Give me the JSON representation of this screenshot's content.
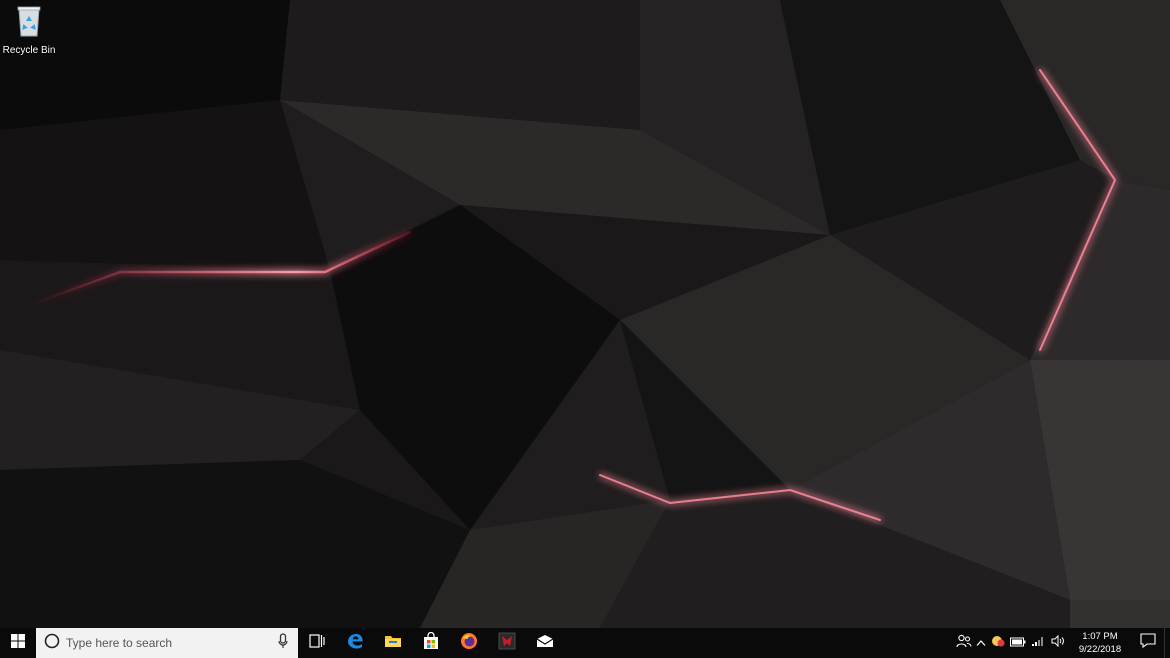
{
  "desktop": {
    "icons": [
      {
        "label": "Recycle Bin",
        "icon": "recycle-bin-icon"
      }
    ]
  },
  "taskbar": {
    "search": {
      "placeholder": "Type here to search"
    },
    "pinned_apps": [
      {
        "name": "task-view",
        "icon": "task-view-icon"
      },
      {
        "name": "edge",
        "icon": "edge-icon",
        "color": "#1e88e5"
      },
      {
        "name": "file-explorer",
        "icon": "folder-icon",
        "color": "#f4c430"
      },
      {
        "name": "store",
        "icon": "store-icon"
      },
      {
        "name": "firefox",
        "icon": "firefox-icon",
        "color": "#ff7a1a"
      },
      {
        "name": "predator-sense",
        "icon": "predator-icon",
        "color": "#c41e2a"
      },
      {
        "name": "mail",
        "icon": "mail-icon"
      }
    ],
    "tray": {
      "icons": [
        "people-icon",
        "chevron-up-icon",
        "app-tray-icon",
        "battery-icon",
        "wifi-icon",
        "volume-icon"
      ]
    },
    "clock": {
      "time": "1:07 PM",
      "date": "9/22/2018"
    }
  }
}
